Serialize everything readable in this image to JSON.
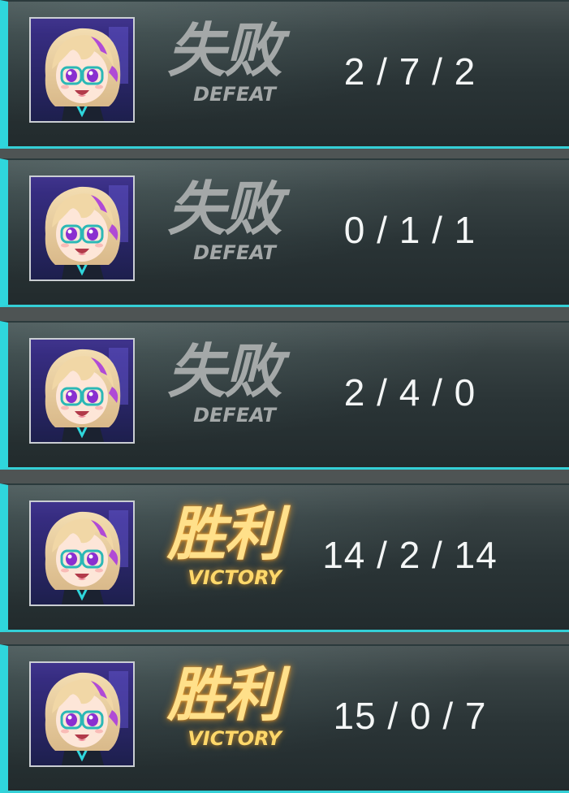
{
  "matches": [
    {
      "result_cn": "失败",
      "result_en": "DEFEAT",
      "kda": "2 / 7 / 2",
      "outcome": "defeat"
    },
    {
      "result_cn": "失败",
      "result_en": "DEFEAT",
      "kda": "0 / 1 / 1",
      "outcome": "defeat"
    },
    {
      "result_cn": "失败",
      "result_en": "DEFEAT",
      "kda": "2 / 4 / 0",
      "outcome": "defeat"
    },
    {
      "result_cn": "胜利",
      "result_en": "VICTORY",
      "kda": "14 / 2 / 14",
      "outcome": "victory"
    },
    {
      "result_cn": "胜利",
      "result_en": "VICTORY",
      "kda": "15 / 0 / 7",
      "outcome": "victory"
    }
  ],
  "colors": {
    "accent": "#2fd6dc",
    "defeat_text": "#a4a8a8",
    "victory_text": "#ffe08a",
    "victory_glow": "#ffaa28",
    "kda_text": "#f4f6f6",
    "panel_bg": "#2a3436"
  },
  "icons": {
    "avatar": "character-portrait-icon"
  }
}
